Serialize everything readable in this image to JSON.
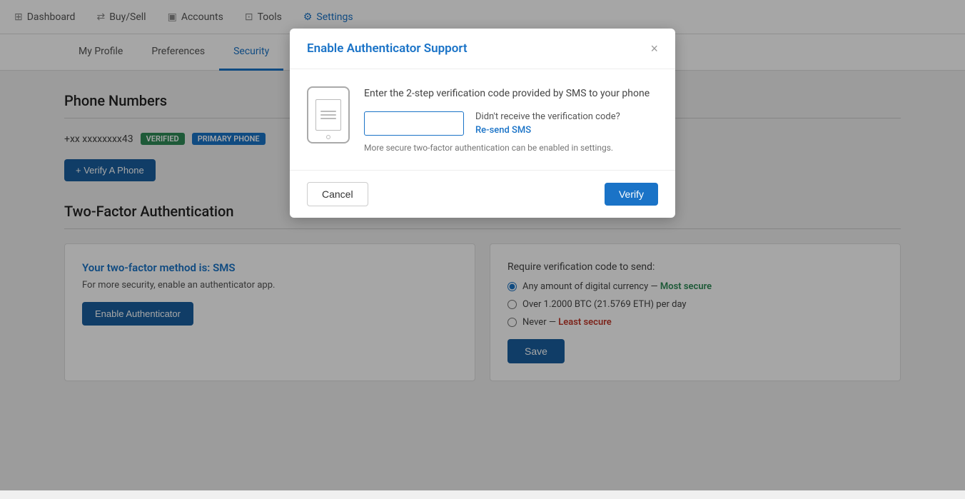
{
  "nav": {
    "items": [
      {
        "id": "dashboard",
        "label": "Dashboard",
        "icon": "⊞",
        "active": false
      },
      {
        "id": "buysell",
        "label": "Buy/Sell",
        "icon": "⇄",
        "active": false
      },
      {
        "id": "accounts",
        "label": "Accounts",
        "icon": "▣",
        "active": false
      },
      {
        "id": "tools",
        "label": "Tools",
        "icon": "⊡",
        "active": false
      },
      {
        "id": "settings",
        "label": "Settings",
        "icon": "⚙",
        "active": true
      }
    ]
  },
  "tabs": [
    {
      "id": "my-profile",
      "label": "My Profile",
      "active": false
    },
    {
      "id": "preferences",
      "label": "Preferences",
      "active": false
    },
    {
      "id": "security",
      "label": "Security",
      "active": true
    }
  ],
  "phone_numbers": {
    "section_title": "Phone Numbers",
    "phone": "+xx xxxxxxxx43",
    "badge_verified": "VERIFIED",
    "badge_primary": "PRIMARY PHONE",
    "add_phone_button": "+ Verify A Phone"
  },
  "two_factor": {
    "section_title": "Two-Factor Authentication",
    "left": {
      "method_label": "Your two-factor method is: SMS",
      "description": "For more security, enable an authenticator app.",
      "enable_button": "Enable Authenticator"
    },
    "right": {
      "require_label": "Require verification code to send:",
      "options": [
        {
          "id": "any",
          "label": "Any amount of digital currency",
          "secure_label": "Most secure",
          "checked": true
        },
        {
          "id": "over",
          "label": "Over 1.2000 BTC (21.5769 ETH) per day",
          "checked": false
        },
        {
          "id": "never",
          "label": "Never",
          "secure_label": "Least secure",
          "checked": false
        }
      ],
      "save_button": "Save"
    }
  },
  "modal": {
    "title": "Enable Authenticator Support",
    "close_icon": "×",
    "instruction": "Enter the 2-step verification code provided by SMS to your phone",
    "input_placeholder": "",
    "resend_question": "Didn't receive the verification code?",
    "resend_link": "Re-send SMS",
    "note": "More secure two-factor authentication can be enabled in settings.",
    "cancel_button": "Cancel",
    "verify_button": "Verify"
  }
}
